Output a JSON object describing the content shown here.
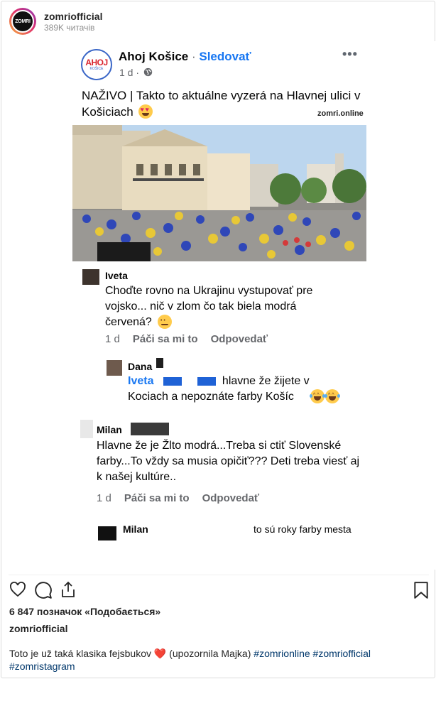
{
  "header": {
    "avatar_text": "ZOMRI",
    "username": "zomriofficial",
    "followers": "389K читачів"
  },
  "embedded_post": {
    "logo_main": "AHOJ",
    "logo_sub": "KOŠICE",
    "page_name": "Ahoj Košice",
    "separator": " · ",
    "follow_label": "Sledovať",
    "time": "1 d ·",
    "more_label": "•••",
    "text": "NAŽIVO | Takto to aktuálne vyzerá na Hlavnej ulici v Košiciach",
    "source": "zomri.online"
  },
  "comments": [
    {
      "name": "Iveta",
      "text": "Choďte rovno na Ukrajinu vystupovať pre vojsko... nič v zlom čo tak biela modrá červená?",
      "time": "1 d",
      "like": "Páči sa mi to",
      "reply": "Odpovedať"
    },
    {
      "name": "Dana",
      "mention": "Iveta",
      "text": "hlavne že žijete v Kociach a nepoznáte farby Košíc"
    },
    {
      "name": "Milan",
      "text": "Hlavne že je Žlto modrá...Treba si ctiť Slovenské farby...To vždy sa musia opičiť??? Deti treba viesť aj k našej kultúre..",
      "time": "1 d",
      "like": "Páči sa mi to",
      "reply": "Odpovedať"
    },
    {
      "name": "Milan",
      "text": "to sú roky farby mesta"
    }
  ],
  "footer": {
    "likes": "6 847 позначок «Подобається»",
    "caption_user": "zomriofficial",
    "caption_text": "Toto je už taká klasika fejsbukov",
    "caption_heart": "❤️",
    "caption_rest": "(upozornila Majka)",
    "hashtags": [
      "#zomrionline",
      "#zomriofficial",
      "#zomristagram"
    ]
  },
  "icons": [
    "heart-icon",
    "comment-icon",
    "share-icon",
    "bookmark-icon"
  ],
  "colors": {
    "accent_blue": "#1877f2",
    "hashtag": "#00376b",
    "text": "#262626",
    "muted": "#8e8e8e"
  }
}
